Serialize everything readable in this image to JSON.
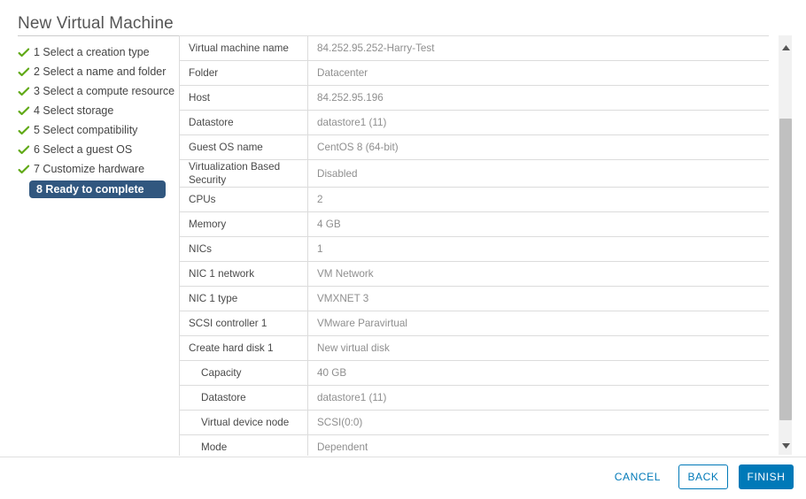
{
  "wizard": {
    "title": "New Virtual Machine"
  },
  "sidebar": {
    "steps": [
      {
        "label": "1 Select a creation type",
        "completed": true,
        "active": false
      },
      {
        "label": "2 Select a name and folder",
        "completed": true,
        "active": false
      },
      {
        "label": "3 Select a compute resource",
        "completed": true,
        "active": false
      },
      {
        "label": "4 Select storage",
        "completed": true,
        "active": false
      },
      {
        "label": "5 Select compatibility",
        "completed": true,
        "active": false
      },
      {
        "label": "6 Select a guest OS",
        "completed": true,
        "active": false
      },
      {
        "label": "7 Customize hardware",
        "completed": true,
        "active": false
      },
      {
        "label": "8 Ready to complete",
        "completed": false,
        "active": true
      }
    ],
    "check_icon": "check-icon",
    "check_color": "#60a917",
    "active_bg": "#31577f"
  },
  "summary": {
    "rows": [
      {
        "key": "Virtual machine name",
        "value": "84.252.95.252-Harry-Test",
        "indent": false,
        "tall": false
      },
      {
        "key": "Folder",
        "value": "Datacenter",
        "indent": false,
        "tall": false
      },
      {
        "key": "Host",
        "value": "84.252.95.196",
        "indent": false,
        "tall": false
      },
      {
        "key": "Datastore",
        "value": "datastore1 (11)",
        "indent": false,
        "tall": false
      },
      {
        "key": "Guest OS name",
        "value": "CentOS 8 (64-bit)",
        "indent": false,
        "tall": false
      },
      {
        "key": "Virtualization Based Security",
        "value": "Disabled",
        "indent": false,
        "tall": true
      },
      {
        "key": "CPUs",
        "value": "2",
        "indent": false,
        "tall": false
      },
      {
        "key": "Memory",
        "value": "4 GB",
        "indent": false,
        "tall": false
      },
      {
        "key": "NICs",
        "value": "1",
        "indent": false,
        "tall": false
      },
      {
        "key": "NIC 1 network",
        "value": "VM Network",
        "indent": false,
        "tall": false
      },
      {
        "key": "NIC 1 type",
        "value": "VMXNET 3",
        "indent": false,
        "tall": false
      },
      {
        "key": "SCSI controller 1",
        "value": "VMware Paravirtual",
        "indent": false,
        "tall": false
      },
      {
        "key": "Create hard disk 1",
        "value": "New virtual disk",
        "indent": false,
        "tall": false
      },
      {
        "key": "Capacity",
        "value": "40 GB",
        "indent": true,
        "tall": false
      },
      {
        "key": "Datastore",
        "value": "datastore1 (11)",
        "indent": true,
        "tall": false
      },
      {
        "key": "Virtual device node",
        "value": "SCSI(0:0)",
        "indent": true,
        "tall": false
      },
      {
        "key": "Mode",
        "value": "Dependent",
        "indent": true,
        "tall": false
      }
    ]
  },
  "scrollbar": {
    "up_icon": "caret-up-icon",
    "down_icon": "caret-down-icon"
  },
  "footer": {
    "cancel_label": "CANCEL",
    "back_label": "BACK",
    "finish_label": "FINISH",
    "accent_color": "#0079b8"
  }
}
